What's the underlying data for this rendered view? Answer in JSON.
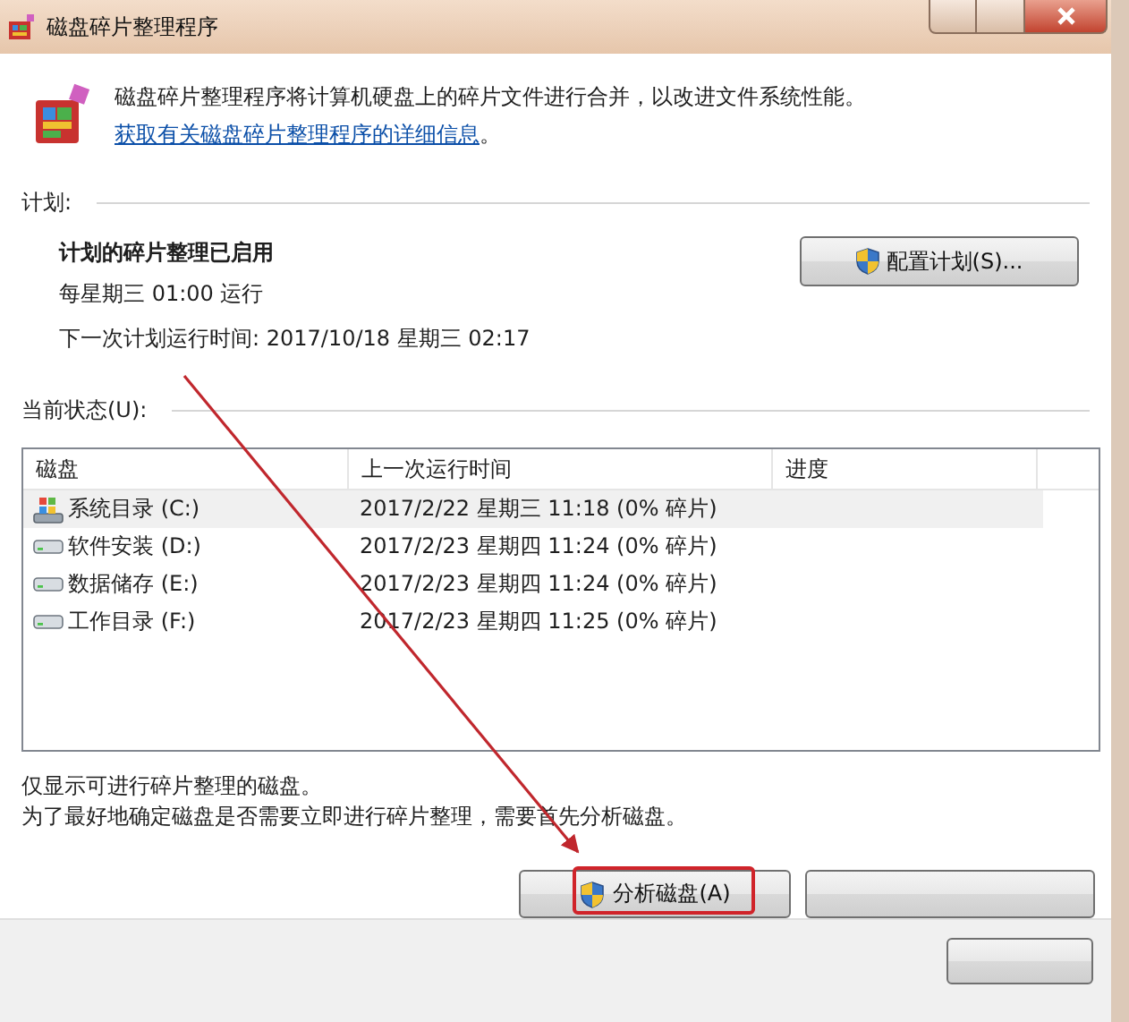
{
  "window": {
    "title": "磁盘碎片整理程序"
  },
  "intro": {
    "text": "磁盘碎片整理程序将计算机硬盘上的碎片文件进行合并，以改进文件系统性能。",
    "link": "获取有关磁盘碎片整理程序的详细信息",
    "after": "。"
  },
  "schedule": {
    "heading": "计划:",
    "status": "计划的碎片整理已启用",
    "frequency": "每星期三  01:00 运行",
    "next_run": "下一次计划运行时间: 2017/10/18 星期三 02:17",
    "button": "配置计划(S)..."
  },
  "current_status": {
    "heading": "当前状态(U):"
  },
  "table": {
    "columns": [
      "磁盘",
      "上一次运行时间",
      "进度"
    ],
    "rows": [
      {
        "kind": "system",
        "disk": "系统目录 (C:)",
        "last_run": "2017/2/22 星期三 11:18 (0% 碎片)",
        "selected": true
      },
      {
        "kind": "drive",
        "disk": "软件安装 (D:)",
        "last_run": "2017/2/23 星期四 11:24 (0% 碎片)",
        "selected": false
      },
      {
        "kind": "drive",
        "disk": "数据储存 (E:)",
        "last_run": "2017/2/23 星期四 11:24 (0% 碎片)",
        "selected": false
      },
      {
        "kind": "drive",
        "disk": "工作目录 (F:)",
        "last_run": "2017/2/23 星期四 11:25 (0% 碎片)",
        "selected": false
      }
    ]
  },
  "notes": [
    "仅显示可进行碎片整理的磁盘。",
    "为了最好地确定磁盘是否需要立即进行碎片整理，需要首先分析磁盘。"
  ],
  "analyze_button": "分析磁盘(A)"
}
